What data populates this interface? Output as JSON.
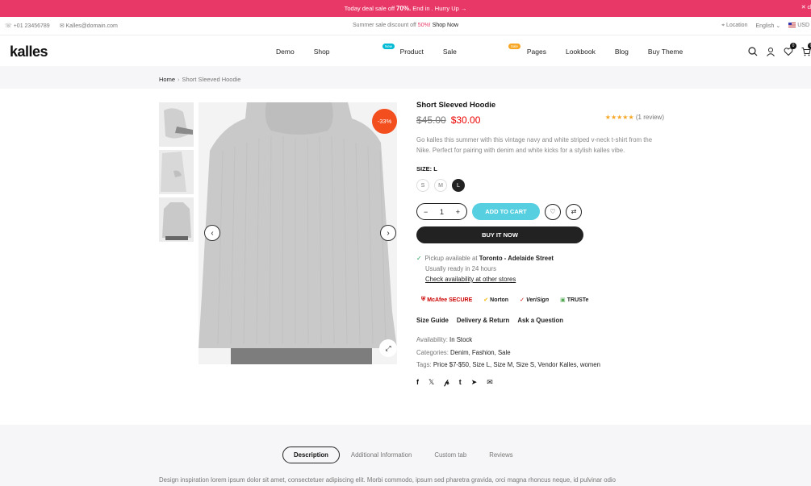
{
  "promo": {
    "text_pre": "Today deal sale off",
    "text_pct": "70%.",
    "text_post": "End in . Hurry Up →",
    "close": "✕ clos"
  },
  "topbar": {
    "phone": "+01 23456789",
    "email": "Kalles@domain.com",
    "summer_pre": "Summer sale discount off",
    "summer_pct": "50%!",
    "summer_link": "Shop Now",
    "location": "Location",
    "language": "English",
    "currency": "USD"
  },
  "header": {
    "logo": "kalles",
    "nav": [
      "Demo",
      "Shop",
      "Product",
      "Sale",
      "Pages",
      "Lookbook",
      "Blog",
      "Buy Theme"
    ],
    "badge_new": "New",
    "badge_sale": "Sale",
    "wishlist_count": "0",
    "cart_count": "0"
  },
  "breadcrumb": {
    "home": "Home",
    "sep": "›",
    "current": "Short Sleeved Hoodie"
  },
  "gallery": {
    "discount": "-33%"
  },
  "product": {
    "title": "Short Sleeved Hoodie",
    "old_price": "$45.00",
    "price": "$30.00",
    "stars": "★★★★★",
    "reviews": "(1 review)",
    "description": "Go kalles this summer with this vintage navy and white striped v-neck t-shirt from the Nike. Perfect for pairing with denim and white kicks for a stylish kalles vibe.",
    "size_label": "SIZE: L",
    "sizes": [
      "S",
      "M",
      "L"
    ],
    "quantity": "1",
    "add_to_cart": "ADD TO CART",
    "buy_now": "BUY IT NOW",
    "pickup_pre": "Pickup available at",
    "pickup_store": "Toronto - Adelaide Street",
    "pickup_ready": "Usually ready in 24 hours",
    "pickup_link": "Check availability at other stores",
    "trust": [
      "McAfee SECURE",
      "Norton",
      "VeriSign",
      "TRUSTe"
    ],
    "info_links": [
      "Size Guide",
      "Delivery & Return",
      "Ask a Question"
    ],
    "availability_label": "Availability:",
    "availability": "In Stock",
    "categories_label": "Categories:",
    "categories": "Denim, Fashion, Sale",
    "tags_label": "Tags:",
    "tags": "Price $7-$50, Size L, Size M, Size S, Vendor Kalles, women"
  },
  "desc_tabs": [
    "Description",
    "Additional Information",
    "Custom tab",
    "Reviews"
  ],
  "desc_text": "Design inspiration lorem ipsum dolor sit amet, consectetuer adipiscing elit. Morbi commodo, ipsum sed pharetra gravida, orci magna rhoncus neque, id pulvinar odio",
  "colors": {
    "promo": "#e83867",
    "discount": "#f24e1e",
    "sale_price": "#ec0101",
    "add_to_cart": "#56cfe1"
  }
}
